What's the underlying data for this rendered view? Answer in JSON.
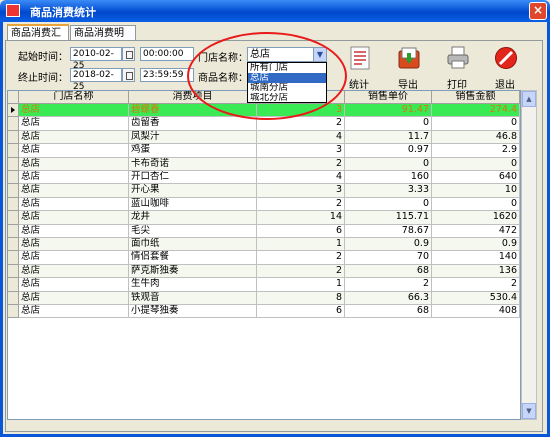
{
  "window": {
    "title": "商品消费统计",
    "close_glyph": "×"
  },
  "tabs": [
    {
      "label": "商品消费汇总"
    },
    {
      "label": "商品消费明细"
    }
  ],
  "filters": {
    "start_label": "起始时间：",
    "start_date": "2010-02-25",
    "start_time": "00:00:00",
    "end_label": "终止时间：",
    "end_date": "2018-02-25",
    "end_time": "23:59:59",
    "store_label": "门店名称：",
    "product_label": "商品名称：",
    "store_selected": "总店",
    "store_options": [
      "所有门店",
      "总店",
      "城南分店",
      "城北分店"
    ],
    "store_highlighted": "总店"
  },
  "toolbar": {
    "stats_label": "统计",
    "export_label": "导出",
    "print_label": "打印",
    "exit_label": "退出"
  },
  "grid": {
    "columns": [
      "门店名称",
      "消费项目",
      "",
      "销售单价",
      "销售金额"
    ],
    "rows": [
      {
        "store": "总店",
        "item": "碧螺春",
        "qty": "3",
        "price": "91.47",
        "amount": "274.4"
      },
      {
        "store": "总店",
        "item": "齿留香",
        "qty": "2",
        "price": "0",
        "amount": "0"
      },
      {
        "store": "总店",
        "item": "凤梨汁",
        "qty": "4",
        "price": "11.7",
        "amount": "46.8"
      },
      {
        "store": "总店",
        "item": "鸡蛋",
        "qty": "3",
        "price": "0.97",
        "amount": "2.9"
      },
      {
        "store": "总店",
        "item": "卡布奇诺",
        "qty": "2",
        "price": "0",
        "amount": "0"
      },
      {
        "store": "总店",
        "item": "开口杏仁",
        "qty": "4",
        "price": "160",
        "amount": "640"
      },
      {
        "store": "总店",
        "item": "开心果",
        "qty": "3",
        "price": "3.33",
        "amount": "10"
      },
      {
        "store": "总店",
        "item": "蓝山咖啡",
        "qty": "2",
        "price": "0",
        "amount": "0"
      },
      {
        "store": "总店",
        "item": "龙井",
        "qty": "14",
        "price": "115.71",
        "amount": "1620"
      },
      {
        "store": "总店",
        "item": "毛尖",
        "qty": "6",
        "price": "78.67",
        "amount": "472"
      },
      {
        "store": "总店",
        "item": "面巾纸",
        "qty": "1",
        "price": "0.9",
        "amount": "0.9"
      },
      {
        "store": "总店",
        "item": "情侣套餐",
        "qty": "2",
        "price": "70",
        "amount": "140"
      },
      {
        "store": "总店",
        "item": "萨克斯独奏",
        "qty": "2",
        "price": "68",
        "amount": "136"
      },
      {
        "store": "总店",
        "item": "生牛肉",
        "qty": "1",
        "price": "2",
        "amount": "2"
      },
      {
        "store": "总店",
        "item": "铁观音",
        "qty": "8",
        "price": "66.3",
        "amount": "530.4"
      },
      {
        "store": "总店",
        "item": "小提琴独奏",
        "qty": "6",
        "price": "68",
        "amount": "408"
      }
    ]
  },
  "colors": {
    "title_bar": "#0a56d8",
    "selected_row_bg": "#3aea55",
    "selected_row_text": "#d47b06",
    "annotation_ring": "#e81a1a"
  }
}
